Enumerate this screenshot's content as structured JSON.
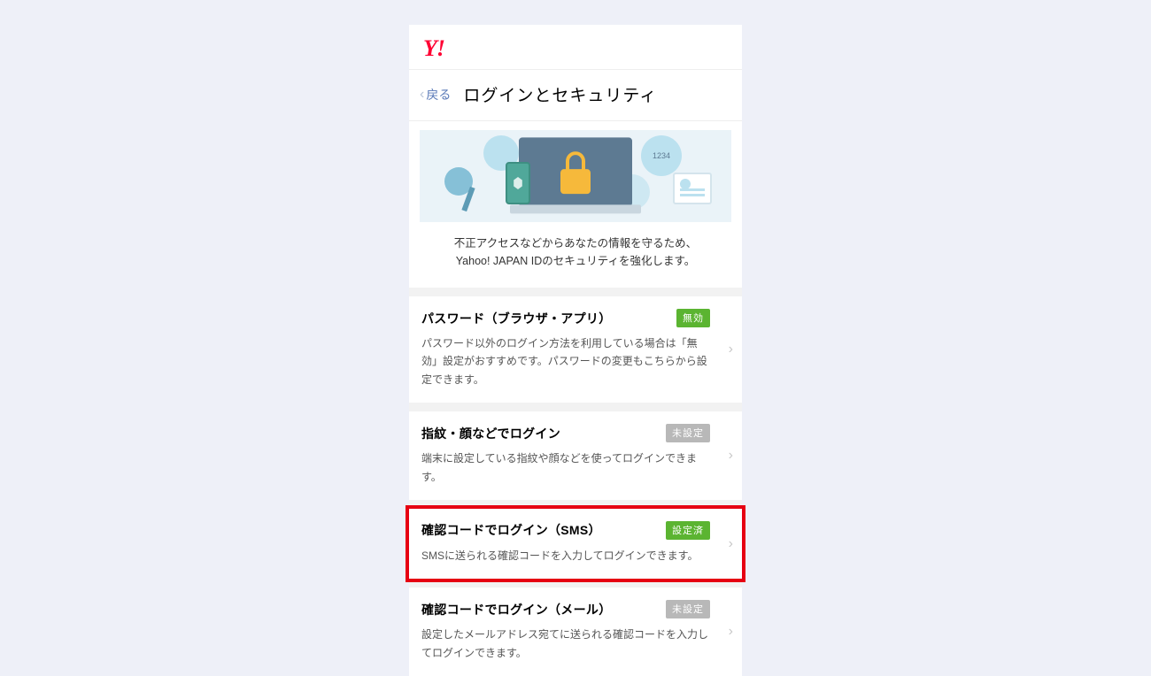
{
  "logo": "Y!",
  "back_label": "戻る",
  "page_title": "ログインとセキュリティ",
  "hero": {
    "pin_hint": "1234",
    "line1": "不正アクセスなどからあなたの情報を守るため、",
    "line2": "Yahoo! JAPAN IDのセキュリティを強化します。"
  },
  "badges": {
    "disabled": "無効",
    "not_set": "未設定",
    "set": "設定済"
  },
  "items": [
    {
      "title": "パスワード（ブラウザ・アプリ）",
      "desc": "パスワード以外のログイン方法を利用している場合は「無効」設定がおすすめです。パスワードの変更もこちらから設定できます。",
      "badge": "disabled",
      "badge_style": "green"
    },
    {
      "title": "指紋・顔などでログイン",
      "desc": "端末に設定している指紋や顔などを使ってログインできます。",
      "badge": "not_set",
      "badge_style": "grey"
    },
    {
      "title": "確認コードでログイン（SMS）",
      "desc": "SMSに送られる確認コードを入力してログインできます。",
      "badge": "set",
      "badge_style": "green",
      "highlight": true
    },
    {
      "title": "確認コードでログイン（メール）",
      "desc": "設定したメールアドレス宛てに送られる確認コードを入力してログインできます。",
      "badge": "not_set",
      "badge_style": "grey"
    }
  ]
}
